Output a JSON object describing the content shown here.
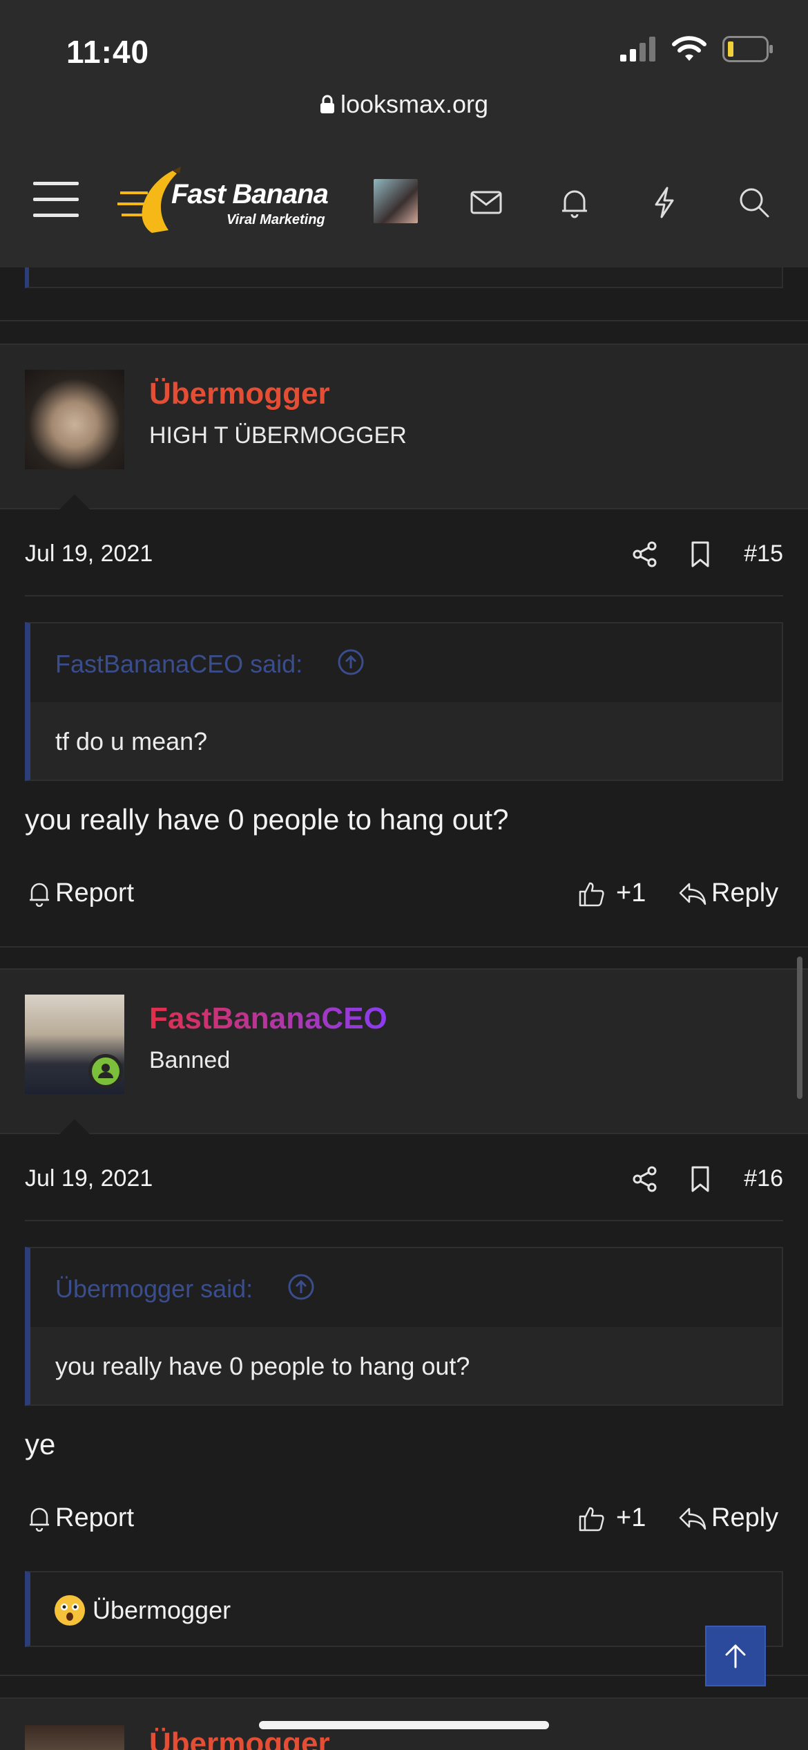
{
  "status_bar": {
    "time": "11:40"
  },
  "browser": {
    "url": "looksmax.org"
  },
  "logo": {
    "title": "Fast Banana",
    "subtitle": "Viral Marketing"
  },
  "posts": [
    {
      "username": "Übermogger",
      "username_color": "#e34e35",
      "user_title": "HIGH T ÜBERMOGGER",
      "date": "Jul 19, 2021",
      "number": "#15",
      "quote_author": "FastBananaCEO said:",
      "quote_text": "tf do u mean?",
      "message": "you really have 0 people to hang out?",
      "report_label": "Report",
      "like_count": "+1",
      "reply_label": "Reply"
    },
    {
      "username": "FastBananaCEO",
      "username_gradient": [
        "#e0304a",
        "#8a3cf0"
      ],
      "user_title": "Banned",
      "date": "Jul 19, 2021",
      "number": "#16",
      "quote_author": "Übermogger said:",
      "quote_text": "you really have 0 people to hang out?",
      "message": "ye",
      "report_label": "Report",
      "like_count": "+1",
      "reply_label": "Reply",
      "reaction_user": "Übermogger"
    }
  ],
  "next_post": {
    "username": "Übermogger"
  },
  "colors": {
    "quote_border": "#2c3e7a",
    "quote_author": "#3a4d8c",
    "scroll_top_button": "#2b4a9c"
  }
}
